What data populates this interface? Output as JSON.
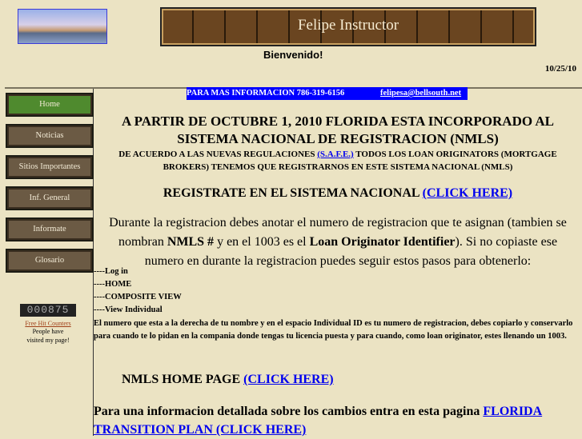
{
  "header": {
    "title": "Felipe Instructor",
    "welcome": "Bienvenido!",
    "date": "10/25/10"
  },
  "info": {
    "text": "PARA MAS INFORMACION 786-319-6156",
    "email": "felipesa@bellsouth.net"
  },
  "nav": [
    "Home",
    "Noticias",
    "Sitios Importantes",
    "Inf. General",
    "Informate",
    "Glosario"
  ],
  "counter": {
    "value": "000875",
    "link": "Free Hit Counters",
    "line1": "People have",
    "line2": "visited my page!"
  },
  "main": {
    "headline": "A PARTIR DE OCTUBRE 1, 2010 FLORIDA ESTA INCORPORADO AL SISTEMA NACIONAL DE REGISTRACION (NMLS)",
    "sub_pre": "DE ACUERDO A LAS NUEVAS REGULACIONES ",
    "sub_link": "(S.A.F.E.)",
    "sub_post": " TODOS LOS LOAN ORIGINATORS (MORTGAGE BROKERS) TENEMOS QUE REGISTRARNOS EN ESTE SISTEMA NACIONAL (NMLS)",
    "register": "REGISTRATE EN EL SISTEMA NACIONAL ",
    "register_link": "(CLICK HERE)",
    "para_1": "Durante la registracion debes anotar el numero de registracion que te asignan (tambien se nombran ",
    "para_b1": "NMLS #",
    "para_2": " y en el 1003 es el ",
    "para_b2": "Loan Originator Identifier",
    "para_3": "). Si no copiaste ese numero en durante la registracion puedes seguir estos pasos para obtenerlo:",
    "steps": [
      "----Log in",
      "----HOME",
      "----COMPOSITE VIEW",
      "----View Individual"
    ],
    "explain": "El numero que esta a la derecha de tu nombre y en el espacio Individual ID es tu numero de registracion, debes copiarlo y conservarlo para cuando te lo pidan en la compania donde tengas tu licencia puesta y para cuando, como loan originator, estes llenando un 1003.",
    "nmls": "NMLS HOME PAGE ",
    "nmls_link": "(CLICK HERE)",
    "final": "Para una informacion detallada sobre los cambios entra en esta pagina ",
    "final_link": "FLORIDA TRANSITION PLAN (CLICK HERE)"
  }
}
